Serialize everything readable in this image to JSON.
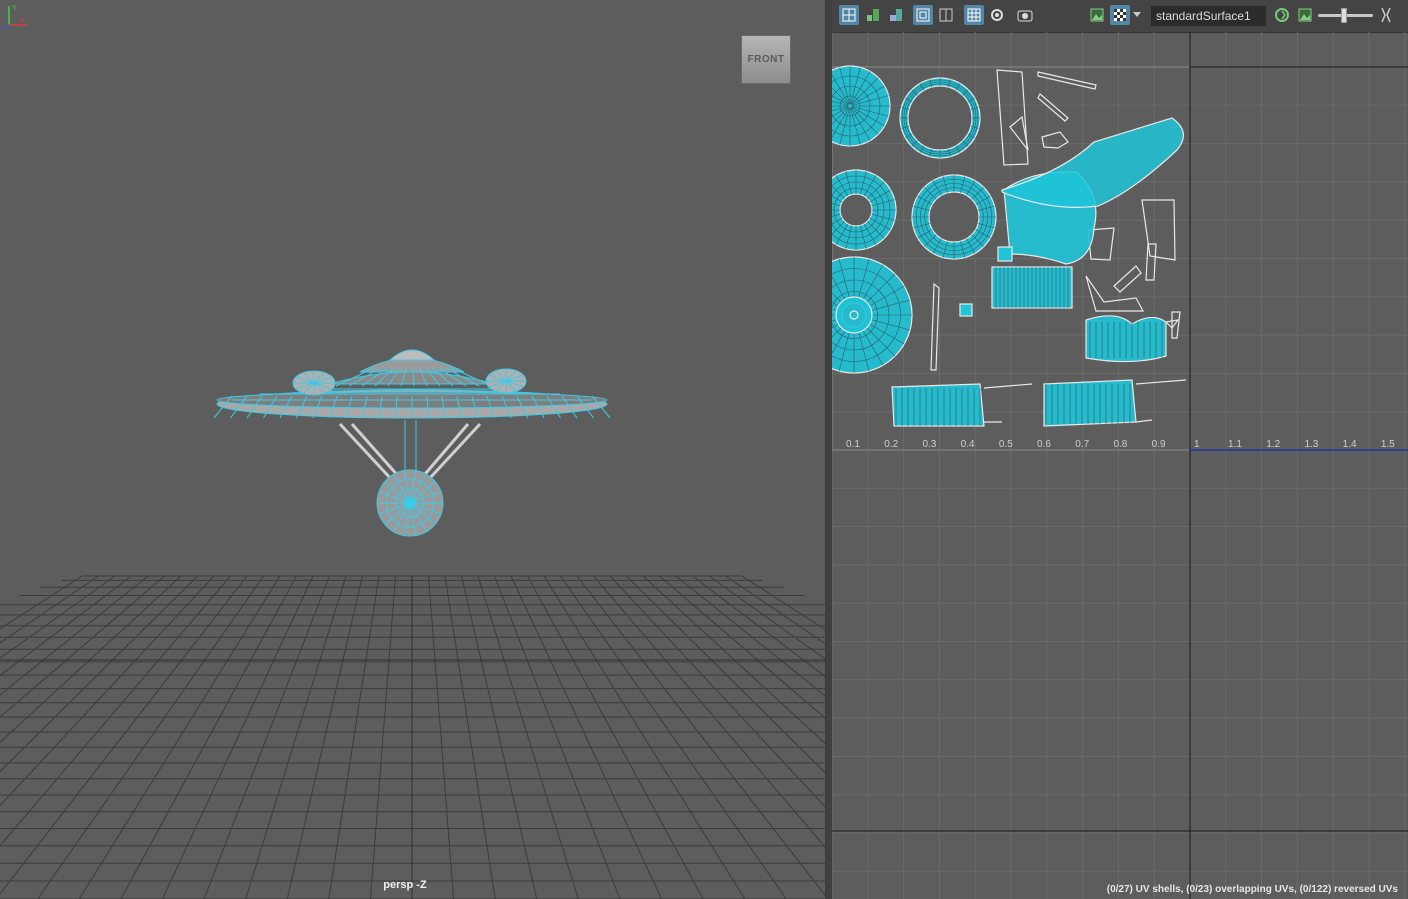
{
  "viewport": {
    "camera_label": "persp -Z",
    "viewcube_label": "FRONT",
    "axis_labels": {
      "x": "X",
      "y": "Y"
    },
    "wire_color": "#3ec9e6",
    "background_color": "#5d5d5d"
  },
  "uv_editor": {
    "toolbar": {
      "shader_name": "standardSurface1",
      "icons": [
        "uv-shell-icon",
        "distortion-icon",
        "texture-tile-icon",
        "wireframe-icon",
        "shaded-icon",
        "grid-icon",
        "pixel-snap-icon",
        "snapshot-icon",
        "image-display-icon",
        "checker-icon",
        "dropdown-arrow-icon",
        "update-psd-icon",
        "photo-icon",
        "exposure-slider",
        "gamma-icon"
      ],
      "exposure_value": 0.42
    },
    "u_axis_ticks": [
      "0.1",
      "0.2",
      "0.3",
      "0.4",
      "0.5",
      "0.6",
      "0.7",
      "0.8",
      "0.9",
      "1",
      "1.1",
      "1.2",
      "1.3",
      "1.4",
      "1.5"
    ],
    "status": "(0/27) UV shells, (0/23) overlapping UVs, (0/122) reversed UVs",
    "uv_color": "#1fc4d8"
  }
}
